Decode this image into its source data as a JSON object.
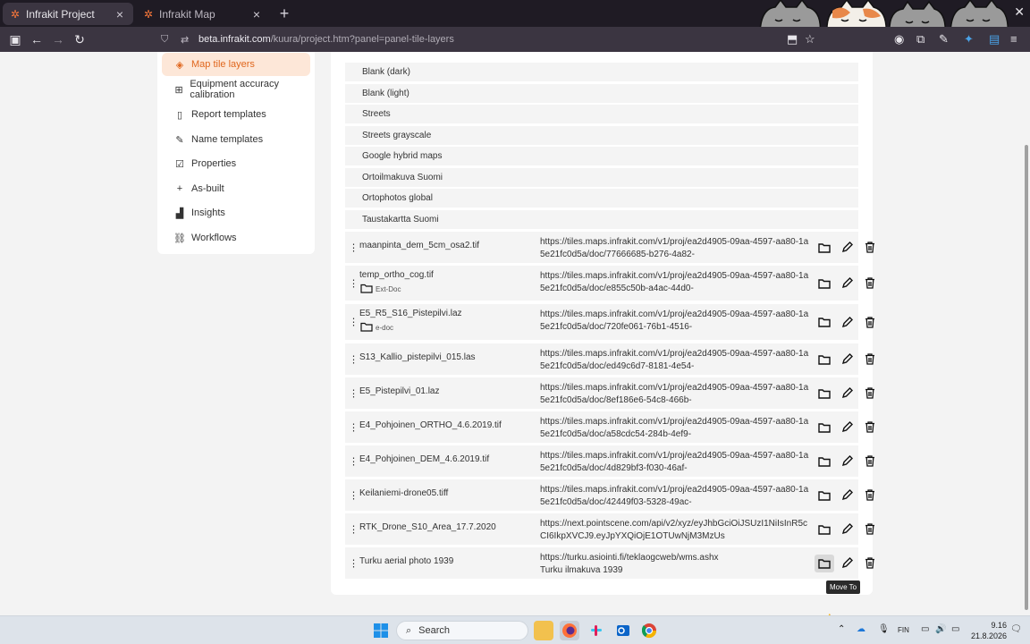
{
  "browser": {
    "tabs": [
      {
        "title": "Infrakit Project",
        "active": true
      },
      {
        "title": "Infrakit Map",
        "active": false
      }
    ],
    "url": {
      "host": "beta.infrakit.com",
      "path": "/kuura/project.htm?panel=panel-tile-layers"
    }
  },
  "sidebar": {
    "items": [
      {
        "label": "Map tile layers",
        "icon": "layers-icon",
        "active": true
      },
      {
        "label": "Equipment accuracy calibration",
        "icon": "calibration-icon",
        "active": false
      },
      {
        "label": "Report templates",
        "icon": "report-icon",
        "active": false
      },
      {
        "label": "Name templates",
        "icon": "pencil-icon",
        "active": false
      },
      {
        "label": "Properties",
        "icon": "properties-icon",
        "active": false
      },
      {
        "label": "As-built",
        "icon": "plus-icon",
        "active": false
      },
      {
        "label": "Insights",
        "icon": "bar-chart-icon",
        "active": false
      },
      {
        "label": "Workflows",
        "icon": "workflow-icon",
        "active": false
      }
    ]
  },
  "base_layers": [
    "Blank (dark)",
    "Blank (light)",
    "Streets",
    "Streets grayscale",
    "Google hybrid maps",
    "Ortoilmakuva Suomi",
    "Ortophotos global",
    "Taustakartta Suomi"
  ],
  "custom_layers": [
    {
      "name": "maanpinta_dem_5cm_osa2.tif",
      "folder": "",
      "url": "https://tiles.maps.infrakit.com/v1/proj/ea2d4905-09aa-4597-aa80-1a5e21fc0d5a/doc/77666685-b276-4a82-"
    },
    {
      "name": "temp_ortho_cog.tif",
      "folder": "Ext-Doc",
      "url": "https://tiles.maps.infrakit.com/v1/proj/ea2d4905-09aa-4597-aa80-1a5e21fc0d5a/doc/e855c50b-a4ac-44d0-"
    },
    {
      "name": "E5_R5_S16_Pistepilvi.laz",
      "folder": "e-doc",
      "url": "https://tiles.maps.infrakit.com/v1/proj/ea2d4905-09aa-4597-aa80-1a5e21fc0d5a/doc/720fe061-76b1-4516-"
    },
    {
      "name": "S13_Kallio_pistepilvi_015.las",
      "folder": "",
      "url": "https://tiles.maps.infrakit.com/v1/proj/ea2d4905-09aa-4597-aa80-1a5e21fc0d5a/doc/ed49c6d7-8181-4e54-"
    },
    {
      "name": "E5_Pistepilvi_01.laz",
      "folder": "",
      "url": "https://tiles.maps.infrakit.com/v1/proj/ea2d4905-09aa-4597-aa80-1a5e21fc0d5a/doc/8ef186e6-54c8-466b-"
    },
    {
      "name": "E4_Pohjoinen_ORTHO_4.6.2019.tif",
      "folder": "",
      "url": "https://tiles.maps.infrakit.com/v1/proj/ea2d4905-09aa-4597-aa80-1a5e21fc0d5a/doc/a58cdc54-284b-4ef9-"
    },
    {
      "name": "E4_Pohjoinen_DEM_4.6.2019.tif",
      "folder": "",
      "url": "https://tiles.maps.infrakit.com/v1/proj/ea2d4905-09aa-4597-aa80-1a5e21fc0d5a/doc/4d829bf3-f030-46af-"
    },
    {
      "name": "Keilaniemi-drone05.tiff",
      "folder": "",
      "url": "https://tiles.maps.infrakit.com/v1/proj/ea2d4905-09aa-4597-aa80-1a5e21fc0d5a/doc/42449f03-5328-49ac-"
    },
    {
      "name": "RTK_Drone_S10_Area_17.7.2020",
      "folder": "",
      "url": "https://next.pointscene.com/api/v2/xyz/eyJhbGciOiJSUzI1NiIsInR5cCI6IkpXVCJ9.eyJpYXQiOjE1OTUwNjM3MzUs"
    },
    {
      "name": "Turku aerial photo 1939",
      "folder": "",
      "url": "https://turku.asiointi.fi/teklaogcweb/wms.ashx\nTurku ilmakuva 1939"
    }
  ],
  "tooltip": "Move To",
  "taskbar": {
    "search_placeholder": "Search",
    "lang": "FIN",
    "time": "9.16",
    "date": "21.8.2026"
  },
  "colors": {
    "accent": "#e0671e",
    "accent_bg": "#fde7d8"
  }
}
